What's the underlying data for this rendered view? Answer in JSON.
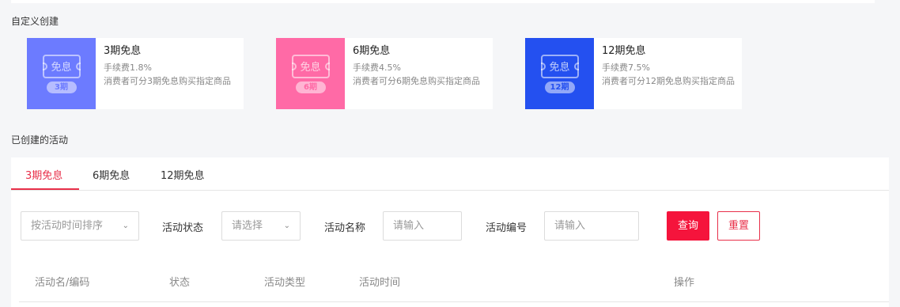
{
  "sections": {
    "custom_title": "自定义创建",
    "created_title": "已创建的活动"
  },
  "colors": {
    "card1": "#6c7bff",
    "card2": "#ff6aa6",
    "card3": "#2450f0",
    "accent": "#e8304a",
    "primary_btn": "#f5143c"
  },
  "cards": [
    {
      "icon": "ticket-icon",
      "icon_text": "免息",
      "pill": "3期",
      "title": "3期免息",
      "fee": "手续费1.8%",
      "desc": "消费者可分3期免息购买指定商品"
    },
    {
      "icon": "ticket-icon",
      "icon_text": "免息",
      "pill": "6期",
      "title": "6期免息",
      "fee": "手续费4.5%",
      "desc": "消费者可分6期免息购买指定商品"
    },
    {
      "icon": "ticket-icon",
      "icon_text": "免息",
      "pill": "12期",
      "title": "12期免息",
      "fee": "手续费7.5%",
      "desc": "消费者可分12期免息购买指定商品"
    }
  ],
  "tabs": [
    "3期免息",
    "6期免息",
    "12期免息"
  ],
  "filters": {
    "sort_select": "按活动时间排序",
    "status_label": "活动状态",
    "status_select": "请选择",
    "name_label": "活动名称",
    "name_placeholder": "请输入",
    "code_label": "活动编号",
    "code_placeholder": "请输入",
    "query_button": "查询",
    "reset_button": "重置"
  },
  "table": {
    "headers": [
      "活动名/编码",
      "状态",
      "活动类型",
      "活动时间",
      "操作"
    ]
  }
}
